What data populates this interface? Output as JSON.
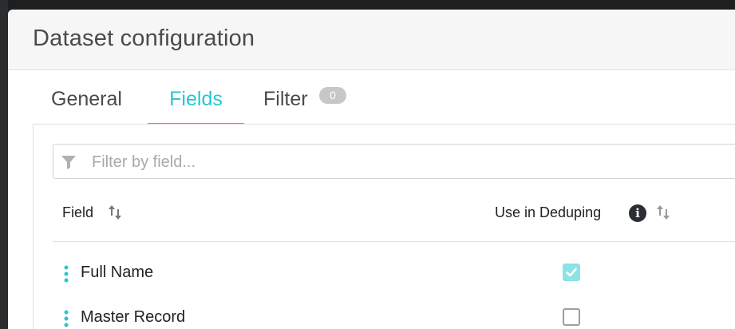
{
  "dialog": {
    "title": "Dataset configuration"
  },
  "tabs": [
    {
      "label": "General",
      "active": false
    },
    {
      "label": "Fields",
      "active": true
    },
    {
      "label": "Filter",
      "active": false,
      "badge": "0"
    }
  ],
  "search": {
    "placeholder": "Filter by field...",
    "value": "",
    "icon": "filter-icon"
  },
  "table": {
    "columns": [
      {
        "label": "Field",
        "sortable": true
      },
      {
        "label": "Use in Deduping",
        "sortable": true,
        "info": true
      }
    ],
    "rows": [
      {
        "label": "Full Name",
        "use_in_deduping": true
      },
      {
        "label": "Master Record",
        "use_in_deduping": false
      }
    ]
  },
  "colors": {
    "accent": "#26c6d0",
    "checked_fill": "#8de2e6",
    "badge": "#c7c7c7"
  }
}
